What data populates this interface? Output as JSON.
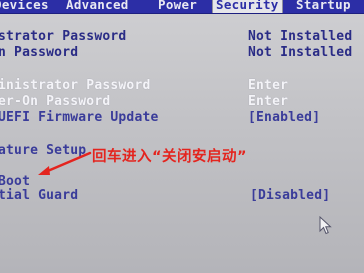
{
  "tabs": [
    {
      "label": "Devices",
      "active": false
    },
    {
      "label": "Advanced",
      "active": false
    },
    {
      "label": "Power",
      "active": false
    },
    {
      "label": "Security",
      "active": true
    },
    {
      "label": "Startup",
      "active": false
    }
  ],
  "rows": [
    {
      "label": "strator Password",
      "value": "Not Installed"
    },
    {
      "label": "n Password",
      "value": "Not Installed"
    },
    {
      "label": "inistrator Password",
      "value": "Enter"
    },
    {
      "label": "er-On Password",
      "value": "Enter"
    },
    {
      "label": " UEFI Firmware Update",
      "value": "[Enabled]"
    },
    {
      "label": "ature Setup",
      "value": ""
    },
    {
      "label": " Boot",
      "value": ""
    },
    {
      "label": "tial Guard",
      "value": "[Disabled]"
    }
  ],
  "annotation": {
    "text": "回车进入“关闭安启动”",
    "color": "#e4241e"
  },
  "colors": {
    "tab_bar": "#2c2ea6",
    "background": "#c6c6ca",
    "setting_text": "#3a3c9a",
    "highlight_text": "#f4f4f8"
  }
}
